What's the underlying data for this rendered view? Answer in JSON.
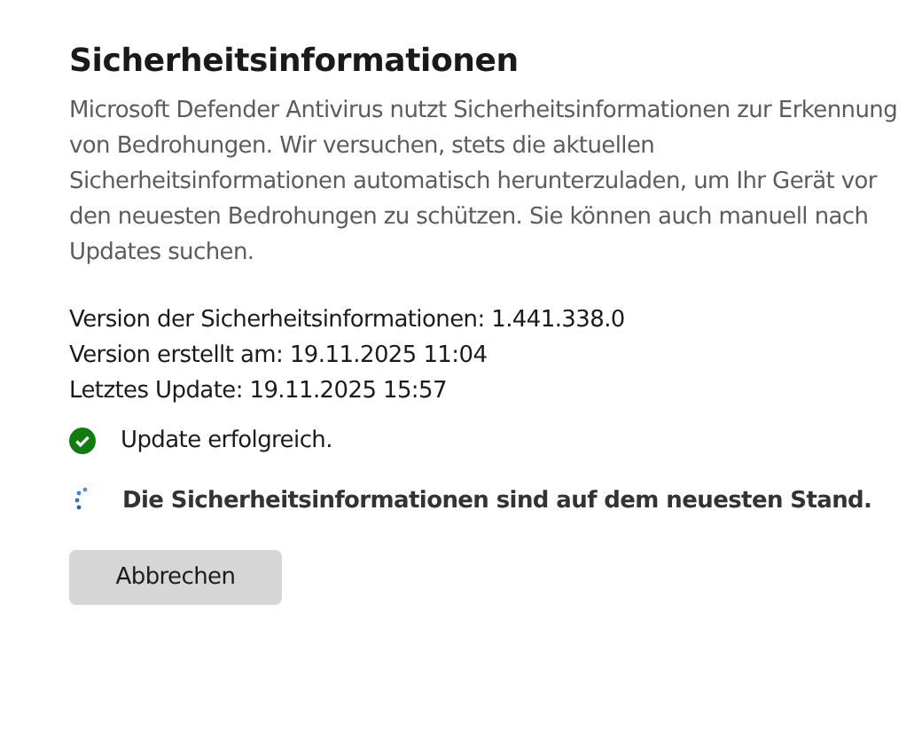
{
  "title": "Sicherheitsinformationen",
  "description": "Microsoft Defender Antivirus nutzt Sicherheitsinformationen zur Erkennung von Bedrohungen. Wir versuchen, stets die aktuellen Sicherheitsinformationen automatisch herunterzuladen, um Ihr Gerät vor den neuesten Bedrohungen zu schützen. Sie können auch manuell nach Updates suchen.",
  "details": [
    "Version der Sicherheitsinformationen: 1.441.338.0",
    "Version erstellt am: 19.11.2025 11:04",
    "Letztes Update: 19.11.2025 15:57"
  ],
  "statuses": [
    {
      "kind": "success",
      "text": "Update erfolgreich."
    },
    {
      "kind": "progress",
      "text": "Die Sicherheitsinformationen sind auf dem neuesten Stand."
    }
  ],
  "button": "Abbrechen"
}
